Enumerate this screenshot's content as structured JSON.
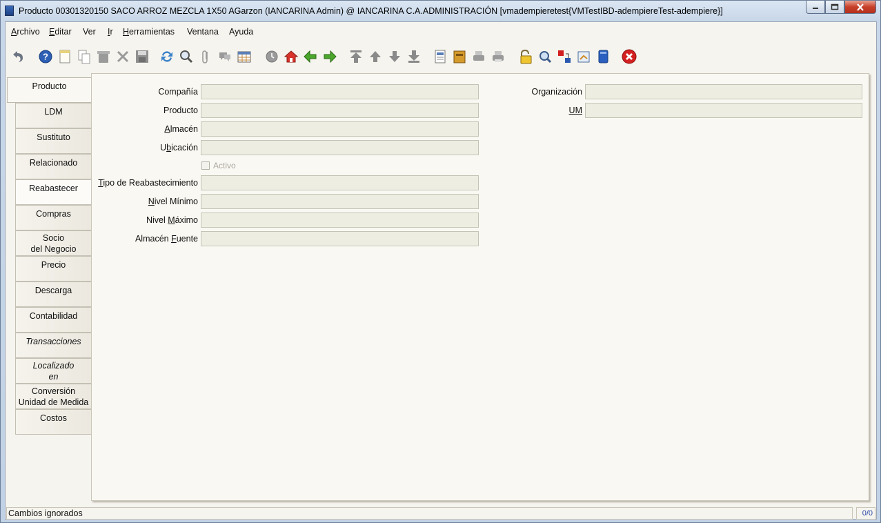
{
  "window": {
    "title": "Producto  00301320150  SACO ARROZ MEZCLA 1X50  AGarzon (IANCARINA Admin) @ IANCARINA C.A.ADMINISTRACIÓN [vmadempieretest{VMTestIBD-adempiereTest-adempiere}]"
  },
  "menu": [
    {
      "label": "Archivo",
      "mnemonic": "A"
    },
    {
      "label": "Editar",
      "mnemonic": "E"
    },
    {
      "label": "Ver",
      "mnemonic": ""
    },
    {
      "label": "Ir",
      "mnemonic": "I"
    },
    {
      "label": "Herramientas",
      "mnemonic": "H"
    },
    {
      "label": "Ventana",
      "mnemonic": ""
    },
    {
      "label": "Ayuda",
      "mnemonic": ""
    }
  ],
  "toolbar": {
    "icons": [
      "undo-icon",
      "help-icon",
      "new-record-icon",
      "copy-record-icon",
      "delete-icon",
      "delete-selection-icon",
      "save-icon",
      "refresh-icon",
      "find-icon",
      "attachment-icon",
      "chat-icon",
      "grid-toggle-icon",
      "history-icon",
      "home-icon",
      "back-icon",
      "forward-icon",
      "first-record-icon",
      "previous-record-icon",
      "next-record-icon",
      "last-record-icon",
      "report-icon",
      "archive-icon",
      "print-preview-icon",
      "print-icon",
      "lock-icon",
      "zoom-across-icon",
      "active-workflows-icon",
      "request-icon",
      "product-info-icon",
      "exit-icon"
    ]
  },
  "tabs": [
    {
      "label": "Producto",
      "selected": true
    },
    {
      "label": "LDM"
    },
    {
      "label": "Sustituto"
    },
    {
      "label": "Relacionado"
    },
    {
      "label": "Reabastecer"
    },
    {
      "label": "Compras"
    },
    {
      "label": "Socio\ndel Negocio"
    },
    {
      "label": "Precio"
    },
    {
      "label": "Descarga"
    },
    {
      "label": "Contabilidad"
    },
    {
      "label": "Transacciones",
      "italic": true
    },
    {
      "label": "Localizado\nen",
      "italic": true
    },
    {
      "label": "Conversión\nUnidad de Medida"
    },
    {
      "label": "Costos"
    }
  ],
  "form": {
    "left_fields": [
      {
        "label": "Compañía",
        "value": ""
      },
      {
        "label": "Producto",
        "value": ""
      },
      {
        "label": "Almacén",
        "value": ""
      },
      {
        "label": "Ubicación",
        "value": ""
      },
      {
        "label": "Tipo de Reabastecimiento",
        "value": ""
      },
      {
        "label": "Nivel Mínimo",
        "value": ""
      },
      {
        "label": "Nivel Máximo",
        "value": ""
      },
      {
        "label": "Almacén Fuente",
        "value": ""
      }
    ],
    "right_fields": [
      {
        "label": "Organización",
        "value": ""
      },
      {
        "label": "UM",
        "value": ""
      }
    ],
    "checkbox": {
      "label": "Activo",
      "checked": false
    }
  },
  "status": {
    "message": "Cambios ignorados",
    "record_count": "0/0"
  }
}
